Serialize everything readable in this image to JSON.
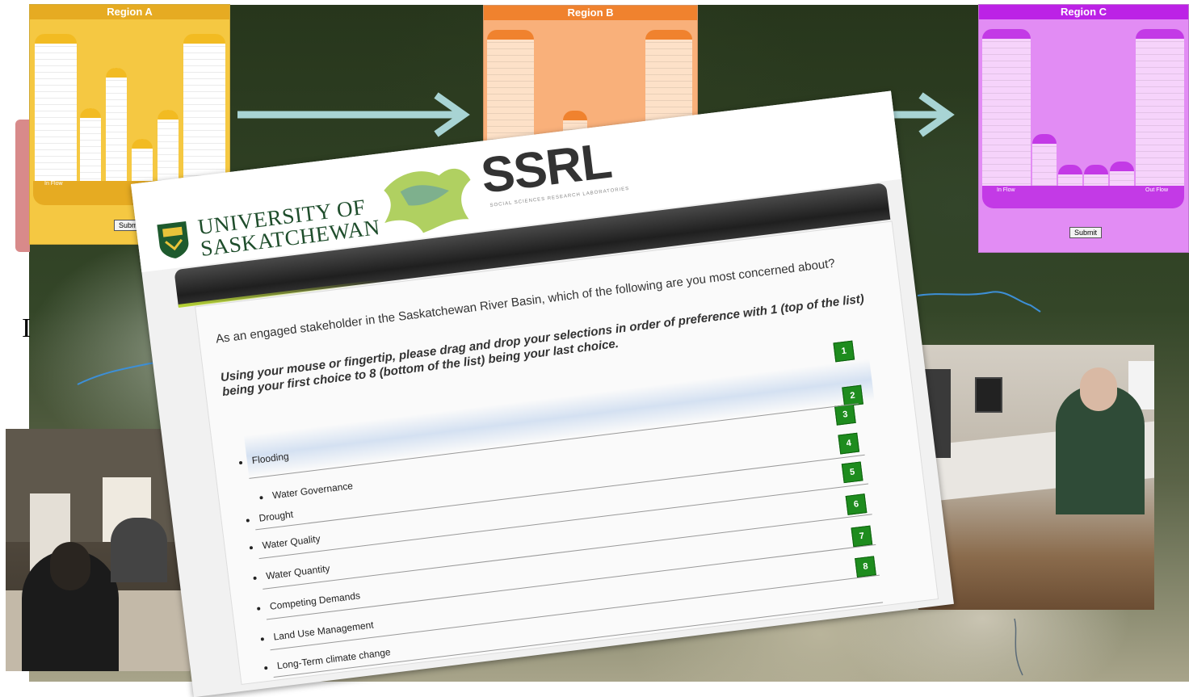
{
  "regions": {
    "a": {
      "title": "Region A",
      "in_flow": "In Flow",
      "submit": "Submit"
    },
    "b": {
      "title": "Region B"
    },
    "c": {
      "title": "Region C",
      "in_flow": "In Flow",
      "out_flow": "Out Flow",
      "submit": "Submit"
    }
  },
  "background_letter": "I",
  "survey": {
    "university": [
      "UNIVERSITY OF",
      "SASKATCHEWAN"
    ],
    "lab_name": "SSRL",
    "lab_subtitle": "SOCIAL SCIENCES RESEARCH LABORATORIES",
    "question": "As an engaged stakeholder in the Saskatchewan River Basin, which of the following are you most concerned about?",
    "instructions": "Using your mouse or fingertip, please drag and drop your selections in order of preference with 1 (top of the list) being your first choice to 8 (bottom of the list) being your last choice.",
    "ranks": [
      "1",
      "2",
      "3",
      "4",
      "5",
      "6",
      "7",
      "8"
    ],
    "items": [
      "Flooding",
      "Water Governance",
      "Drought",
      "Water Quality",
      "Water Quantity",
      "Competing Demands",
      "Land Use Management",
      "Long-Term climate change"
    ]
  },
  "colors": {
    "region_a": "#f5c842",
    "region_b": "#f9b07a",
    "region_c": "#e28cf4",
    "rank_badge": "#1e8c1e",
    "arrow": "#a8d4d4"
  }
}
